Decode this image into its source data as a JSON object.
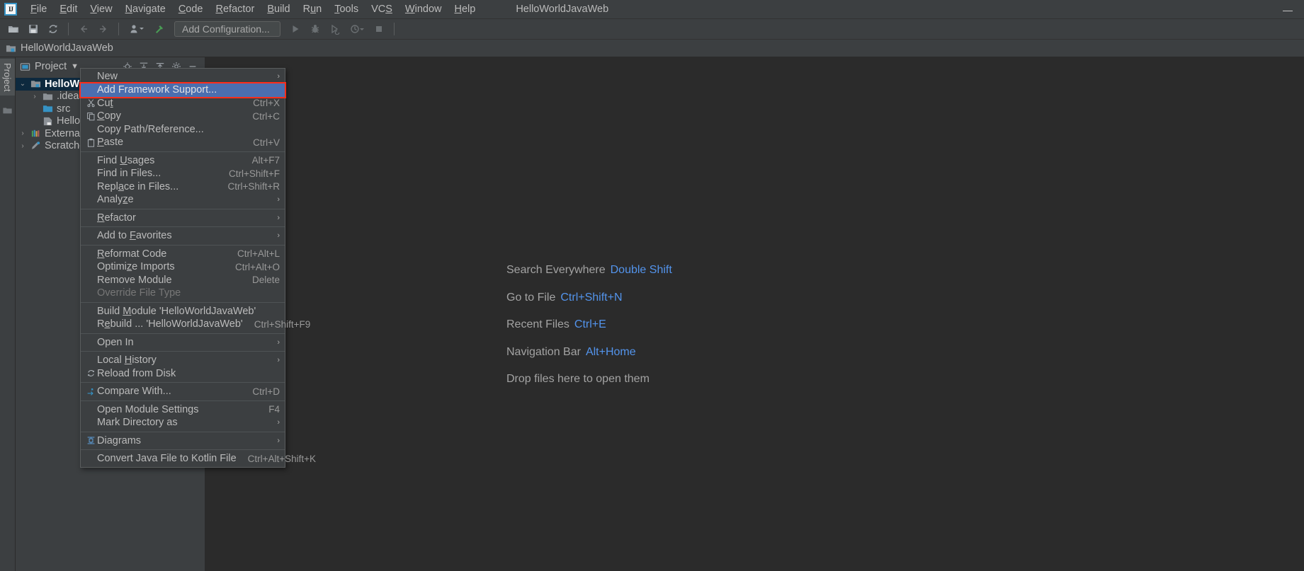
{
  "window": {
    "title": "HelloWorldJavaWeb",
    "minimize_label": "—",
    "maximize_label": "□",
    "close_label": "✕"
  },
  "menubar": {
    "logo_text": "IJ",
    "items": [
      {
        "label": "File",
        "mnemonic": "F"
      },
      {
        "label": "Edit",
        "mnemonic": "E"
      },
      {
        "label": "View",
        "mnemonic": "V"
      },
      {
        "label": "Navigate",
        "mnemonic": "N"
      },
      {
        "label": "Code",
        "mnemonic": "C"
      },
      {
        "label": "Refactor",
        "mnemonic": "R"
      },
      {
        "label": "Build",
        "mnemonic": "B"
      },
      {
        "label": "Run",
        "mnemonic": "u"
      },
      {
        "label": "Tools",
        "mnemonic": "T"
      },
      {
        "label": "VCS",
        "mnemonic": "S"
      },
      {
        "label": "Window",
        "mnemonic": "W"
      },
      {
        "label": "Help",
        "mnemonic": "H"
      }
    ]
  },
  "toolbar": {
    "open_icon": "folder-open-icon",
    "save_icon": "save-icon",
    "sync_icon": "refresh-icon",
    "back_icon": "arrow-left-icon",
    "forward_icon": "arrow-right-icon",
    "vcs_icon": "vcs-update-icon",
    "build_icon": "build-hammer-icon",
    "run_config_label": "Add Configuration...",
    "run_icon": "run-play-icon",
    "debug_icon": "debug-bug-icon",
    "coverage_icon": "run-coverage-icon",
    "profile_icon": "profiler-icon",
    "stop_icon": "stop-square-icon"
  },
  "navbar": {
    "project_label": "HelloWorldJavaWeb",
    "module_icon": "module-folder-icon"
  },
  "left_strip": {
    "project_tab": "Project",
    "structure_icon": "structure-icon"
  },
  "project_panel": {
    "header_title": "Project",
    "view_icon": "project-view-icon",
    "dropdown_icon": "chevron-down-icon",
    "actions": [
      {
        "name": "locate-icon"
      },
      {
        "name": "expand-all-icon"
      },
      {
        "name": "collapse-all-icon"
      },
      {
        "name": "gear-icon"
      },
      {
        "name": "hide-icon"
      }
    ],
    "tree": [
      {
        "label": "HelloWorldJavaWeb",
        "sub": "",
        "icon": "module-icon",
        "arrow": "⌄",
        "depth": 0,
        "selected": true
      },
      {
        "label": ".idea",
        "sub": "",
        "icon": "folder-icon",
        "arrow": "›",
        "depth": 1,
        "selected": false
      },
      {
        "label": "src",
        "sub": "",
        "icon": "source-folder-icon",
        "arrow": "",
        "depth": 1,
        "selected": false
      },
      {
        "label": "HelloWo",
        "sub": "",
        "icon": "iml-file-icon",
        "arrow": "",
        "depth": 1,
        "selected": false
      },
      {
        "label": "External Libr",
        "sub": "",
        "icon": "libraries-icon",
        "arrow": "›",
        "depth": 0,
        "selected": false
      },
      {
        "label": "Scratches a",
        "sub": "",
        "icon": "scratches-icon",
        "arrow": "›",
        "depth": 0,
        "selected": false
      }
    ]
  },
  "editor": {
    "hints": [
      {
        "label": "Search Everywhere",
        "key": "Double Shift"
      },
      {
        "label": "Go to File",
        "key": "Ctrl+Shift+N"
      },
      {
        "label": "Recent Files",
        "key": "Ctrl+E"
      },
      {
        "label": "Navigation Bar",
        "key": "Alt+Home"
      },
      {
        "label": "Drop files here to open them",
        "key": ""
      }
    ]
  },
  "context_menu": {
    "highlight_color": "#ff2d19",
    "selection_color": "#4b6eaf",
    "items": [
      {
        "type": "item",
        "label": "New",
        "mnemonic": "",
        "shortcut": "",
        "submenu": true,
        "icon": "",
        "disabled": false,
        "highlighted": false
      },
      {
        "type": "item",
        "label": "Add Framework Support...",
        "mnemonic": "",
        "shortcut": "",
        "submenu": false,
        "icon": "",
        "disabled": false,
        "highlighted": true
      },
      {
        "type": "item",
        "label": "Cut",
        "mnemonic": "t",
        "shortcut": "Ctrl+X",
        "submenu": false,
        "icon": "cut-scissors-icon",
        "disabled": false,
        "highlighted": false
      },
      {
        "type": "item",
        "label": "Copy",
        "mnemonic": "C",
        "shortcut": "Ctrl+C",
        "submenu": false,
        "icon": "copy-icon",
        "disabled": false,
        "highlighted": false
      },
      {
        "type": "item",
        "label": "Copy Path/Reference...",
        "mnemonic": "",
        "shortcut": "",
        "submenu": false,
        "icon": "",
        "disabled": false,
        "highlighted": false
      },
      {
        "type": "item",
        "label": "Paste",
        "mnemonic": "P",
        "shortcut": "Ctrl+V",
        "submenu": false,
        "icon": "paste-clipboard-icon",
        "disabled": false,
        "highlighted": false
      },
      {
        "type": "separator"
      },
      {
        "type": "item",
        "label": "Find Usages",
        "mnemonic": "U",
        "shortcut": "Alt+F7",
        "submenu": false,
        "icon": "",
        "disabled": false,
        "highlighted": false
      },
      {
        "type": "item",
        "label": "Find in Files...",
        "mnemonic": "",
        "shortcut": "Ctrl+Shift+F",
        "submenu": false,
        "icon": "",
        "disabled": false,
        "highlighted": false
      },
      {
        "type": "item",
        "label": "Replace in Files...",
        "mnemonic": "a",
        "shortcut": "Ctrl+Shift+R",
        "submenu": false,
        "icon": "",
        "disabled": false,
        "highlighted": false
      },
      {
        "type": "item",
        "label": "Analyze",
        "mnemonic": "z",
        "shortcut": "",
        "submenu": true,
        "icon": "",
        "disabled": false,
        "highlighted": false
      },
      {
        "type": "separator"
      },
      {
        "type": "item",
        "label": "Refactor",
        "mnemonic": "R",
        "shortcut": "",
        "submenu": true,
        "icon": "",
        "disabled": false,
        "highlighted": false
      },
      {
        "type": "separator"
      },
      {
        "type": "item",
        "label": "Add to Favorites",
        "mnemonic": "F",
        "shortcut": "",
        "submenu": true,
        "icon": "",
        "disabled": false,
        "highlighted": false
      },
      {
        "type": "separator"
      },
      {
        "type": "item",
        "label": "Reformat Code",
        "mnemonic": "R",
        "shortcut": "Ctrl+Alt+L",
        "submenu": false,
        "icon": "",
        "disabled": false,
        "highlighted": false
      },
      {
        "type": "item",
        "label": "Optimize Imports",
        "mnemonic": "z",
        "shortcut": "Ctrl+Alt+O",
        "submenu": false,
        "icon": "",
        "disabled": false,
        "highlighted": false
      },
      {
        "type": "item",
        "label": "Remove Module",
        "mnemonic": "",
        "shortcut": "Delete",
        "submenu": false,
        "icon": "",
        "disabled": false,
        "highlighted": false
      },
      {
        "type": "item",
        "label": "Override File Type",
        "mnemonic": "",
        "shortcut": "",
        "submenu": false,
        "icon": "",
        "disabled": true,
        "highlighted": false
      },
      {
        "type": "separator"
      },
      {
        "type": "item",
        "label": "Build Module 'HelloWorldJavaWeb'",
        "mnemonic": "M",
        "shortcut": "",
        "submenu": false,
        "icon": "",
        "disabled": false,
        "highlighted": false
      },
      {
        "type": "item",
        "label": "Rebuild ... 'HelloWorldJavaWeb'",
        "mnemonic": "e",
        "shortcut": "Ctrl+Shift+F9",
        "submenu": false,
        "icon": "",
        "disabled": false,
        "highlighted": false
      },
      {
        "type": "separator"
      },
      {
        "type": "item",
        "label": "Open In",
        "mnemonic": "",
        "shortcut": "",
        "submenu": true,
        "icon": "",
        "disabled": false,
        "highlighted": false
      },
      {
        "type": "separator"
      },
      {
        "type": "item",
        "label": "Local History",
        "mnemonic": "H",
        "shortcut": "",
        "submenu": true,
        "icon": "",
        "disabled": false,
        "highlighted": false
      },
      {
        "type": "item",
        "label": "Reload from Disk",
        "mnemonic": "",
        "shortcut": "",
        "submenu": false,
        "icon": "reload-icon",
        "disabled": false,
        "highlighted": false
      },
      {
        "type": "separator"
      },
      {
        "type": "item",
        "label": "Compare With...",
        "mnemonic": "",
        "shortcut": "Ctrl+D",
        "submenu": false,
        "icon": "compare-icon",
        "disabled": false,
        "highlighted": false
      },
      {
        "type": "separator"
      },
      {
        "type": "item",
        "label": "Open Module Settings",
        "mnemonic": "",
        "shortcut": "F4",
        "submenu": false,
        "icon": "",
        "disabled": false,
        "highlighted": false
      },
      {
        "type": "item",
        "label": "Mark Directory as",
        "mnemonic": "",
        "shortcut": "",
        "submenu": true,
        "icon": "",
        "disabled": false,
        "highlighted": false
      },
      {
        "type": "separator"
      },
      {
        "type": "item",
        "label": "Diagrams",
        "mnemonic": "",
        "shortcut": "",
        "submenu": true,
        "icon": "diagram-icon",
        "disabled": false,
        "highlighted": false
      },
      {
        "type": "separator"
      },
      {
        "type": "item",
        "label": "Convert Java File to Kotlin File",
        "mnemonic": "",
        "shortcut": "Ctrl+Alt+Shift+K",
        "submenu": false,
        "icon": "",
        "disabled": false,
        "highlighted": false
      }
    ]
  }
}
